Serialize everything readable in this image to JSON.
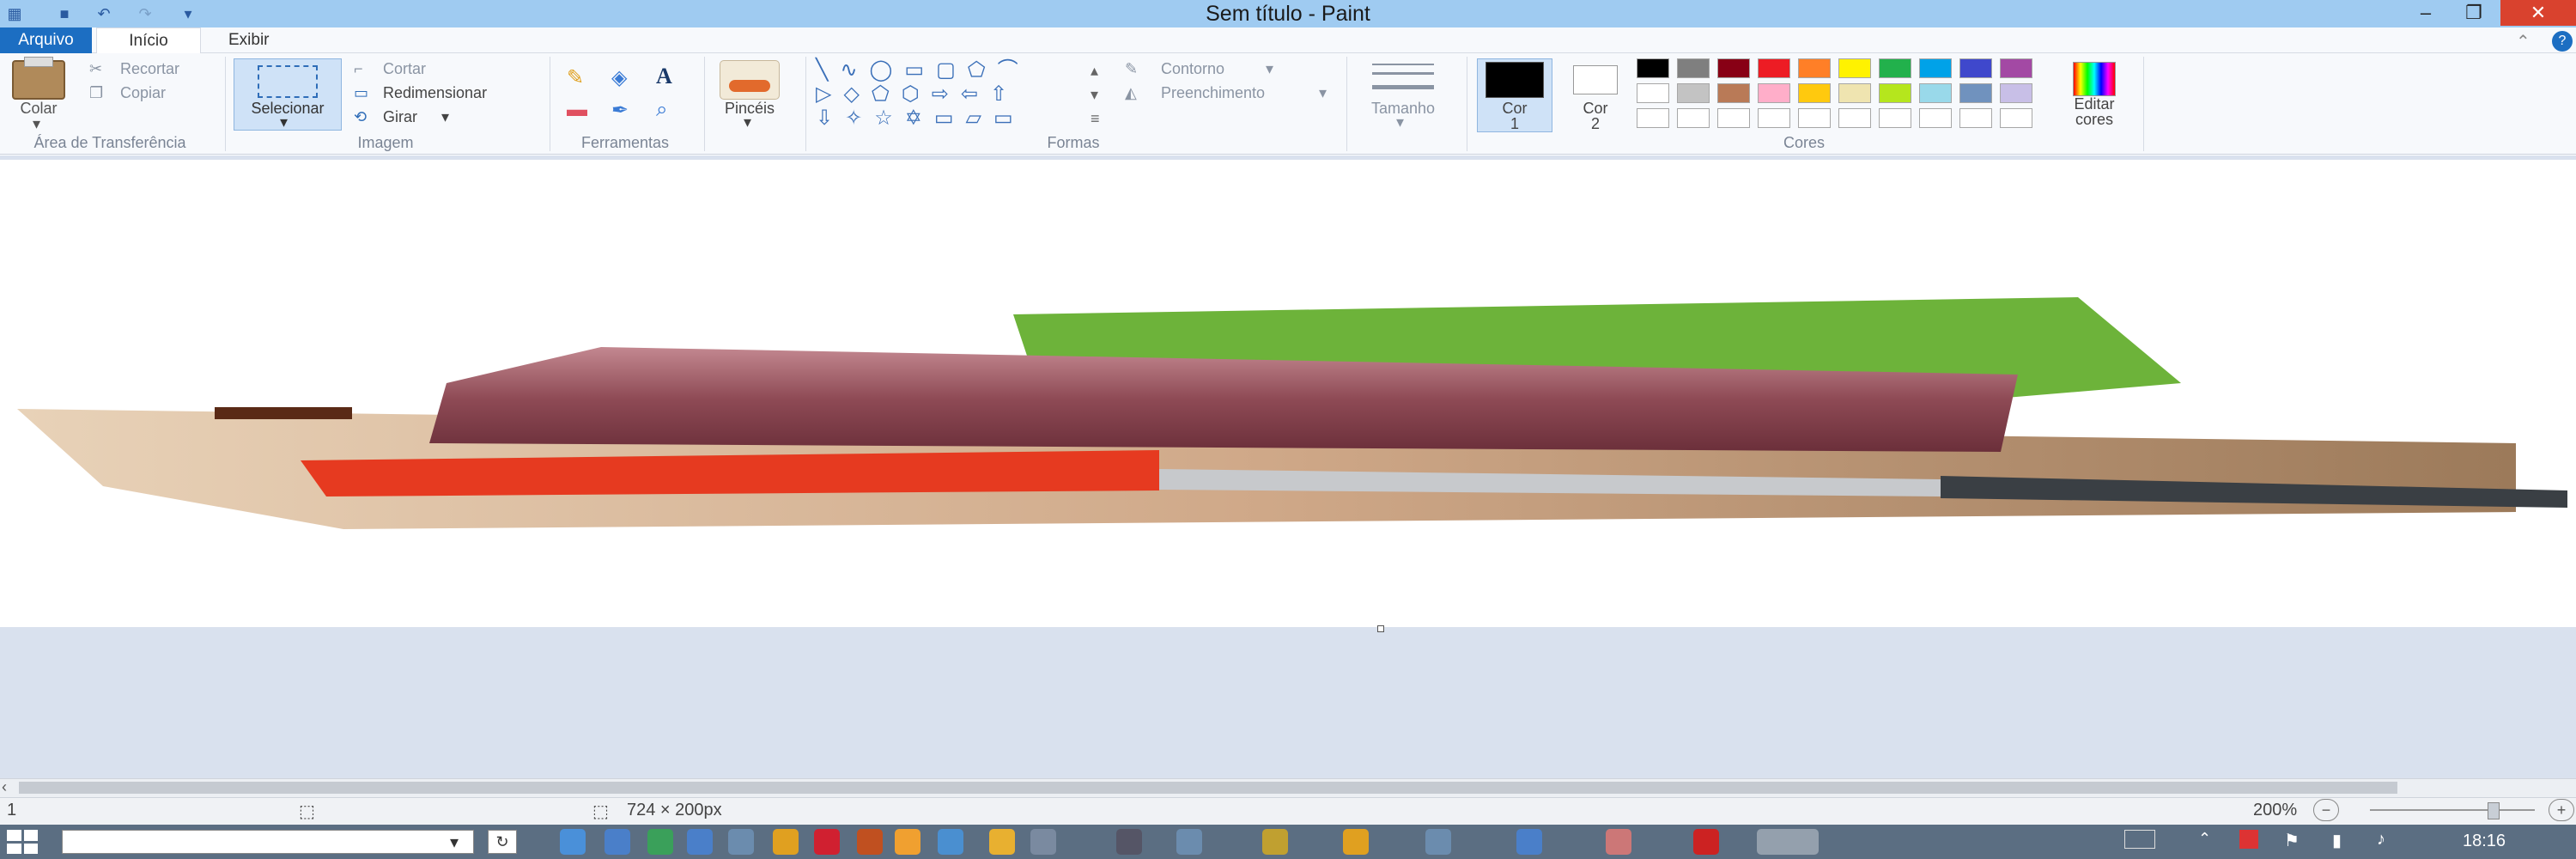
{
  "window": {
    "title": "Sem título - Paint",
    "minimize": "–",
    "restore": "❐",
    "close": "✕"
  },
  "tabs": {
    "file": "Arquivo",
    "home": "Início",
    "view": "Exibir"
  },
  "clipboard": {
    "paste": "Colar",
    "cut": "Recortar",
    "copy": "Copiar",
    "group": "Área de Transferência"
  },
  "image": {
    "select": "Selecionar",
    "crop": "Cortar",
    "resize": "Redimensionar",
    "rotate": "Girar",
    "group": "Imagem"
  },
  "tools": {
    "group": "Ferramentas",
    "text_glyph": "A"
  },
  "brushes": {
    "label": "Pincéis"
  },
  "shapes": {
    "outline": "Contorno",
    "fill": "Preenchimento",
    "group": "Formas"
  },
  "size": {
    "label": "Tamanho"
  },
  "colors": {
    "color1_label": "Cor",
    "color1_num": "1",
    "color2_label": "Cor",
    "color2_num": "2",
    "edit": "Editar cores",
    "group": "Cores",
    "color1_value": "#000000",
    "color2_value": "#ffffff",
    "palette_row1": [
      "#000000",
      "#7f7f7f",
      "#880015",
      "#ed1c24",
      "#ff7f27",
      "#fff200",
      "#22b14c",
      "#00a2e8",
      "#3f48cc",
      "#a349a4"
    ],
    "palette_row2": [
      "#ffffff",
      "#c3c3c3",
      "#b97a57",
      "#ffaec9",
      "#ffc90e",
      "#efe4b0",
      "#b5e61d",
      "#99d9ea",
      "#7092be",
      "#c8bfe7"
    ]
  },
  "status": {
    "size": "724 × 200px",
    "zoom": "200%",
    "left_marker": "1"
  },
  "taskbar": {
    "time": "18:16"
  }
}
